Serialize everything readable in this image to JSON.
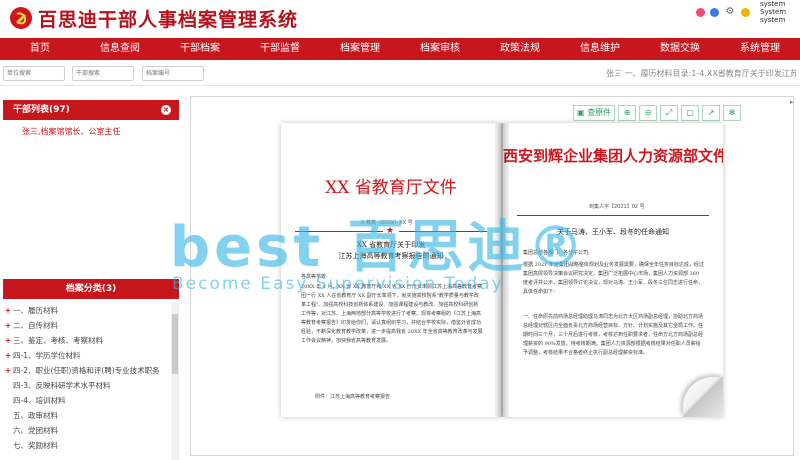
{
  "header": {
    "title": "百思迪干部人事档案管理系统",
    "user_lines": [
      "system",
      "System",
      "system"
    ]
  },
  "nav": [
    "首页",
    "信息查阅",
    "干部档案",
    "干部监督",
    "档案管理",
    "档案审核",
    "政策法规",
    "信息维护",
    "数据交换",
    "系统管理"
  ],
  "search": {
    "unit_placeholder": "单位搜索",
    "cadre_placeholder": "干部搜索",
    "file_placeholder": "档案编号",
    "breadcrumb": "张三 一、履历材料目录:1-4.XX省教育厅关于印发江苏上海..."
  },
  "cadre_panel": {
    "title": "干部列表(97)",
    "items": [
      "张三,档案馆馆长、公室主任"
    ]
  },
  "category_panel": {
    "title": "档案分类(3)",
    "items": [
      {
        "label": "一、履历材料",
        "expandable": true
      },
      {
        "label": "二、自传材料",
        "expandable": true
      },
      {
        "label": "三、鉴定、考核、考察材料",
        "expandable": true
      },
      {
        "label": "四-1、学历学位材料",
        "expandable": true
      },
      {
        "label": "四-2、职业(任职)资格和评(聘)专业技术职务",
        "expandable": true
      },
      {
        "label": "四-3、反映科研学术水平材料",
        "expandable": false
      },
      {
        "label": "四-4、培训材料",
        "expandable": false
      },
      {
        "label": "五、政审材料",
        "expandable": false
      },
      {
        "label": "六、党团材料",
        "expandable": false
      },
      {
        "label": "七、奖励材料",
        "expandable": false
      }
    ]
  },
  "toolbar": {
    "original_label": "查原件",
    "icons": [
      "zoom-in-icon",
      "zoom-out-icon",
      "fullscreen-icon",
      "fit-page-icon",
      "export-icon",
      "settings-icon"
    ]
  },
  "document": {
    "left": {
      "title": "XX 省教育厅文件",
      "doc_number": "X 教高〔20XX〕XX 号",
      "subject_line1": "XX 省教育厅关于印发",
      "subject_line2": "江苏上海高等教育考察报告的通知",
      "recipient": "各高等学校:",
      "body": "20XX 年 4 月，XX 省 XX 教育厅和 XX 省 XX 厅厅长率领江苏上海高等教育考察团一行 XX 人在省教育厅 XX 副厅长率领下，就实施高校院系\"教学质量与教学改革工程\"、加强高校科技创新体系建设、加强课程建设与教改、加强高校科研创新工作等，对江苏、上海两地部分高等学校进行了考察。现将考察组的《江苏上海高等教育考察报告》印发给你们，请认真组织学习，并结合学校实际，借鉴外省成功经验，不断深化教育教学改革，进一步提高我省 20XX 年全省高等教育改革与发展工作会议精神，加快我省高等教育发展。",
      "attachment": "附件：江苏上海高等教育考察报告"
    },
    "right": {
      "title": "西安到辉企业集团人力资源部文件",
      "doc_number": "到集人字【2021】02 号",
      "subject": "关于马涛、王小军、段冬的任命通知",
      "recipient": "集团总部各部门、各分子公司:",
      "body": "根据 2021 年全集团战略整体规划及业务发展需要，确保全年任务目标达成，经过集团高层领导决策会议研究决定，集团广泛拓展中心市场，集团人力资源部 360 度考评并公示，集团领导讨论决议，现对马涛、王小军、段冬三位同志进行任命，具体任命如下：",
      "item": "一、任命原先前商场总经理助理马涛同志为北方大区商场副总经理，协助北方商场总经理对辖区内全面负责北方商场经营目标、方针、计划实施及其它全局工作。任期时间三个月，三个月后进行考核，考核达到任职要求者，任命方北方商场副总经理薪资的 90%发放。待考核期满，集团人力资源部根据考核结果对任职人员薪给予调整，考核结果不合格者终止执行副总经理薪资标准。"
    }
  },
  "watermark": {
    "brand": "百思迪®",
    "letters": "best",
    "slogan": "Become Easy Supervision Today"
  },
  "colors": {
    "brand_red": "#c8161d",
    "doc_red": "#d0161d",
    "toolbar_green": "#2a9d61",
    "watermark_blue": "#35b6e6"
  }
}
